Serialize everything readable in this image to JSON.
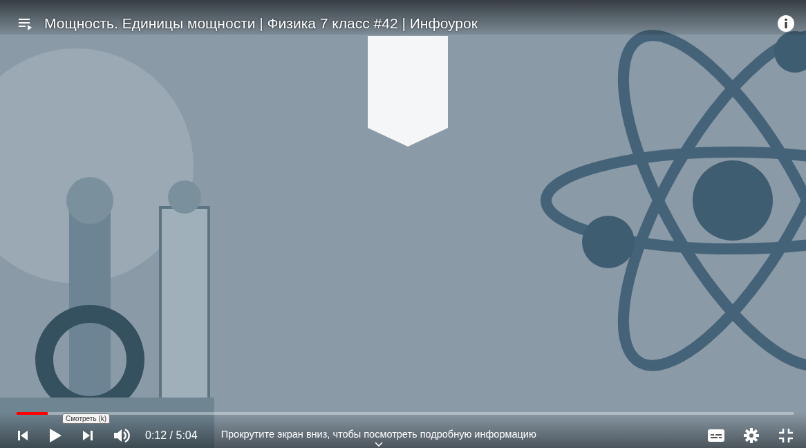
{
  "title": "Мощность. Единицы мощности | Физика 7 класс #42 | Инфоурок",
  "progress": {
    "level": 0.04
  },
  "tooltip": "Смотреть (k)",
  "time": {
    "current": "0:12",
    "separator": "/",
    "duration": "5:04"
  },
  "scroll_hint": "Прокрутите экран вниз, чтобы посмотреть подробную информацию"
}
